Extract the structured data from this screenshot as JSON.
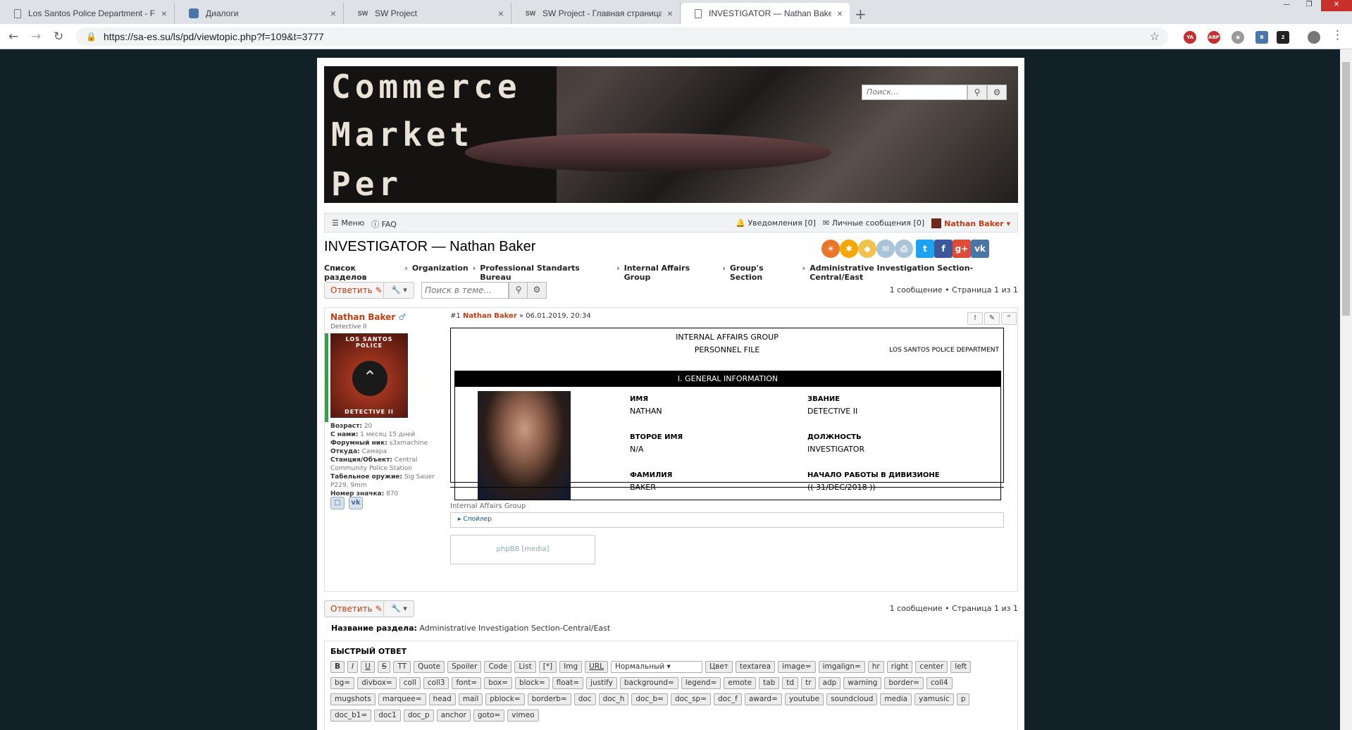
{
  "browser": {
    "tabs": [
      {
        "title": "Los Santos Police Department - F",
        "icon": "doc"
      },
      {
        "title": "Диалоги",
        "icon": "chat"
      },
      {
        "title": "SW Project",
        "icon": "sw"
      },
      {
        "title": "SW Project - Главная страница",
        "icon": "sw"
      },
      {
        "title": "INVESTIGATOR — Nathan Baker",
        "icon": "doc"
      }
    ],
    "url": "https://sa-es.su/ls/pd/viewtopic.php?f=109&t=3777",
    "tab_close": "×",
    "new_tab": "+",
    "ext_badge": "2"
  },
  "header": {
    "banner_lines": [
      "Commerce",
      "Market",
      "Per"
    ],
    "search_placeholder": "Поиск..."
  },
  "navbar": {
    "menu": "Меню",
    "faq": "FAQ",
    "notifications": "Уведомления [0]",
    "messages": "Личные сообщения [0]",
    "user": "Nathan Baker ▾"
  },
  "topic": {
    "title": "INVESTIGATOR — Nathan Baker",
    "breadcrumbs": [
      "Список разделов",
      "Organization",
      "Professional Standarts Bureau",
      "Internal Affairs Group",
      "Group's Section",
      "Administrative Investigation Section-Central/East"
    ],
    "reply_label": "Ответить",
    "search_placeholder": "Поиск в теме...",
    "pagination": "1 сообщение • Страница 1 из 1"
  },
  "post": {
    "author": "Nathan Baker",
    "rank": "Detective II",
    "avatar_top": "LOS SANTOS POLICE",
    "avatar_bottom": "DETECTIVE II",
    "fields": [
      {
        "k": "Возраст:",
        "v": "20"
      },
      {
        "k": "С нами:",
        "v": "1 месяц 15 дней"
      },
      {
        "k": "Форумный ник:",
        "v": "s3xmachine"
      },
      {
        "k": "Откуда:",
        "v": "Самара"
      },
      {
        "k": "Станция/Объект:",
        "v": "Central Community Police Station"
      },
      {
        "k": "Табельное оружие:",
        "v": "Sig Sauer P229, 9mm"
      },
      {
        "k": "Номер значка:",
        "v": "870"
      }
    ],
    "number": "#1",
    "date": "» 06.01.2019, 20:34",
    "file": {
      "line1": "INTERNAL AFFAIRS GROUP",
      "line2": "PERSONNEL FILE",
      "dept": "LOS SANTOS POLICE DEPARTMENT",
      "band": "I. GENERAL INFORMATION",
      "first_name_label": "ИМЯ",
      "first_name": "NATHAN",
      "middle_name_label": "ВТОРОЕ ИМЯ",
      "middle_name": "N/A",
      "last_name_label": "ФАМИЛИЯ",
      "last_name": "BAKER",
      "rank_label": "ЗВАНИЕ",
      "rank": "DETECTIVE II",
      "position_label": "ДОЛЖНОСТЬ",
      "position": "INVESTIGATOR",
      "start_label": "НАЧАЛО РАБОТЫ В ДИВИЗИОНЕ",
      "start": "(( 31/DEC/2018 ))"
    },
    "signature": "Internal Affairs Group",
    "spoiler": "Спойлер",
    "media": "phpBB [media]"
  },
  "forum_name_label": "Название раздела:",
  "forum_name": "Administrative Investigation Section-Central/East",
  "quick_reply": {
    "title": "БЫСТРЫЙ ОТВЕТ",
    "rows": [
      [
        "B",
        "I",
        "U",
        "S",
        "TT",
        "Quote",
        "Spoiler",
        "Code",
        "List",
        "[*]",
        "Img",
        "URL",
        "Нормальный ▾",
        "Цвет",
        "textarea",
        "image=",
        "imgalign=",
        "hr",
        "right",
        "center",
        "left"
      ],
      [
        "bg=",
        "divbox=",
        "coll",
        "coll3",
        "font=",
        "box=",
        "block=",
        "float=",
        "justify",
        "background=",
        "legend=",
        "emote",
        "tab",
        "td",
        "tr",
        "adp",
        "warning",
        "border=",
        "coll4"
      ],
      [
        "mugshots",
        "marquee=",
        "head",
        "mail",
        "pblock=",
        "borderb=",
        "doc",
        "doc_h",
        "doc_b=",
        "doc_sp=",
        "doc_f",
        "award=",
        "youtube",
        "soundcloud",
        "media",
        "yamusic",
        "p"
      ],
      [
        "doc_b1=",
        "doc1",
        "doc_p",
        "anchor",
        "goto=",
        "vimeo"
      ]
    ]
  }
}
